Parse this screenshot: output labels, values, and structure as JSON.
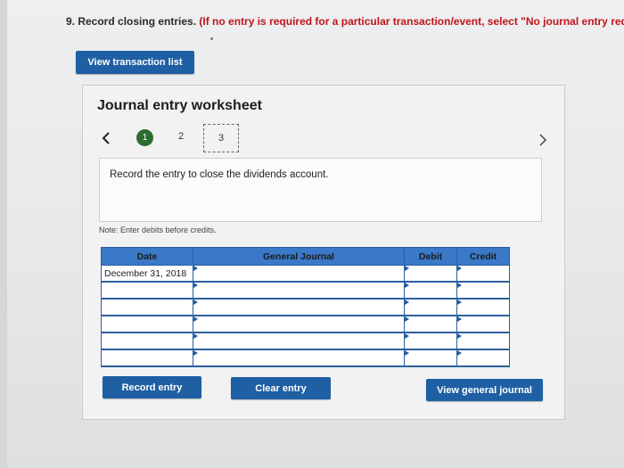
{
  "question": {
    "label": "9. Record closing entries.",
    "instruction": "(If no entry is required for a particular transaction/event, select \"No journal entry requir"
  },
  "buttons": {
    "view_transaction_list": "View transaction list",
    "record_entry": "Record entry",
    "clear_entry": "Clear entry",
    "view_general_journal": "View general journal"
  },
  "worksheet": {
    "title": "Journal entry worksheet",
    "steps": [
      "1",
      "2",
      "3"
    ],
    "active_step": "1",
    "selected_step": "3",
    "description": "Record the entry to close the dividends account.",
    "note": "Note: Enter debits before credits."
  },
  "journal": {
    "headers": {
      "date": "Date",
      "general_journal": "General Journal",
      "debit": "Debit",
      "credit": "Credit"
    },
    "rows": [
      {
        "date": "December 31, 2018",
        "account": "",
        "debit": "",
        "credit": ""
      },
      {
        "date": "",
        "account": "",
        "debit": "",
        "credit": ""
      },
      {
        "date": "",
        "account": "",
        "debit": "",
        "credit": ""
      },
      {
        "date": "",
        "account": "",
        "debit": "",
        "credit": ""
      },
      {
        "date": "",
        "account": "",
        "debit": "",
        "credit": ""
      },
      {
        "date": "",
        "account": "",
        "debit": "",
        "credit": ""
      }
    ]
  },
  "colors": {
    "primary_button": "#1f5fa3",
    "table_header": "#3a78c8",
    "active_step": "#2d6b2f",
    "instruction_red": "#c0141b"
  }
}
